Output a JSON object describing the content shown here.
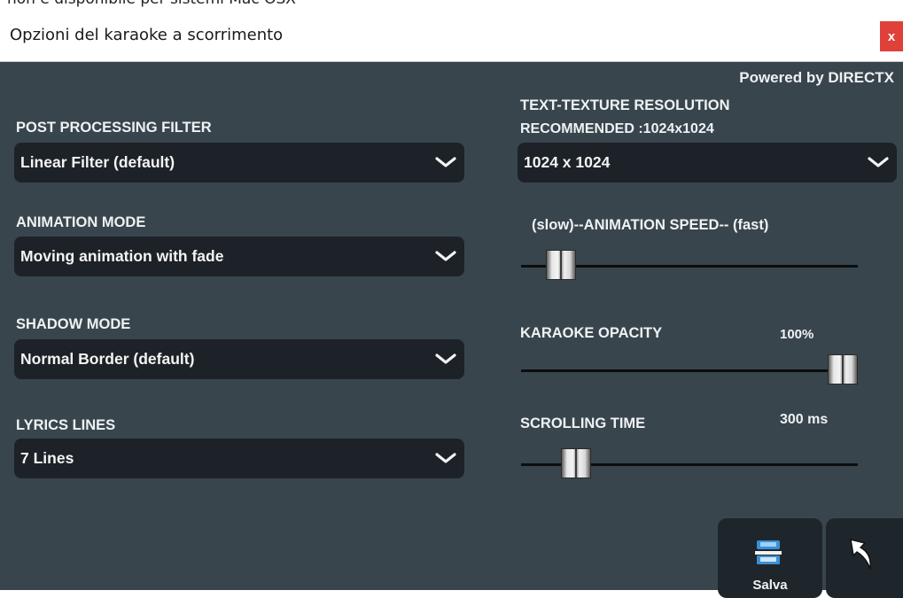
{
  "top_note": "non è disponibile per sistemi Mac OSX",
  "window": {
    "title": "Opzioni del karaoke a scorrimento",
    "close_label": "x",
    "powered_by": "Powered by DIRECTX"
  },
  "left": {
    "post_filter": {
      "label": "POST PROCESSING FILTER",
      "value": "Linear Filter (default)"
    },
    "animation_mode": {
      "label": "ANIMATION MODE",
      "value": "Moving animation with fade"
    },
    "shadow_mode": {
      "label": "SHADOW MODE",
      "value": "Normal Border (default)"
    },
    "lyrics_lines": {
      "label": "LYRICS LINES",
      "value": "7 Lines"
    }
  },
  "right": {
    "texture": {
      "label_line1": "TEXT-TEXTURE RESOLUTION",
      "label_line2": "RECOMMENDED :1024x1024",
      "value": "1024 x 1024"
    },
    "animation_speed": {
      "label": "(slow)--ANIMATION SPEED-- (fast)",
      "level": 0.08
    },
    "opacity": {
      "label": "KARAOKE OPACITY",
      "value_text": "100%",
      "level": 1.0
    },
    "scrolling_time": {
      "label": "SCROLLING TIME",
      "value_text": "300 ms",
      "level": 0.13
    }
  },
  "buttons": {
    "save_label": "Salva"
  },
  "colors": {
    "panel_bg": "#39454c",
    "dropdown_bg": "#1c2227",
    "close_red": "#e0403a",
    "text": "#eef2f4"
  },
  "icons": {
    "save": "save-icon",
    "back": "back-arrow-icon",
    "chevron": "chevron-down-icon"
  }
}
